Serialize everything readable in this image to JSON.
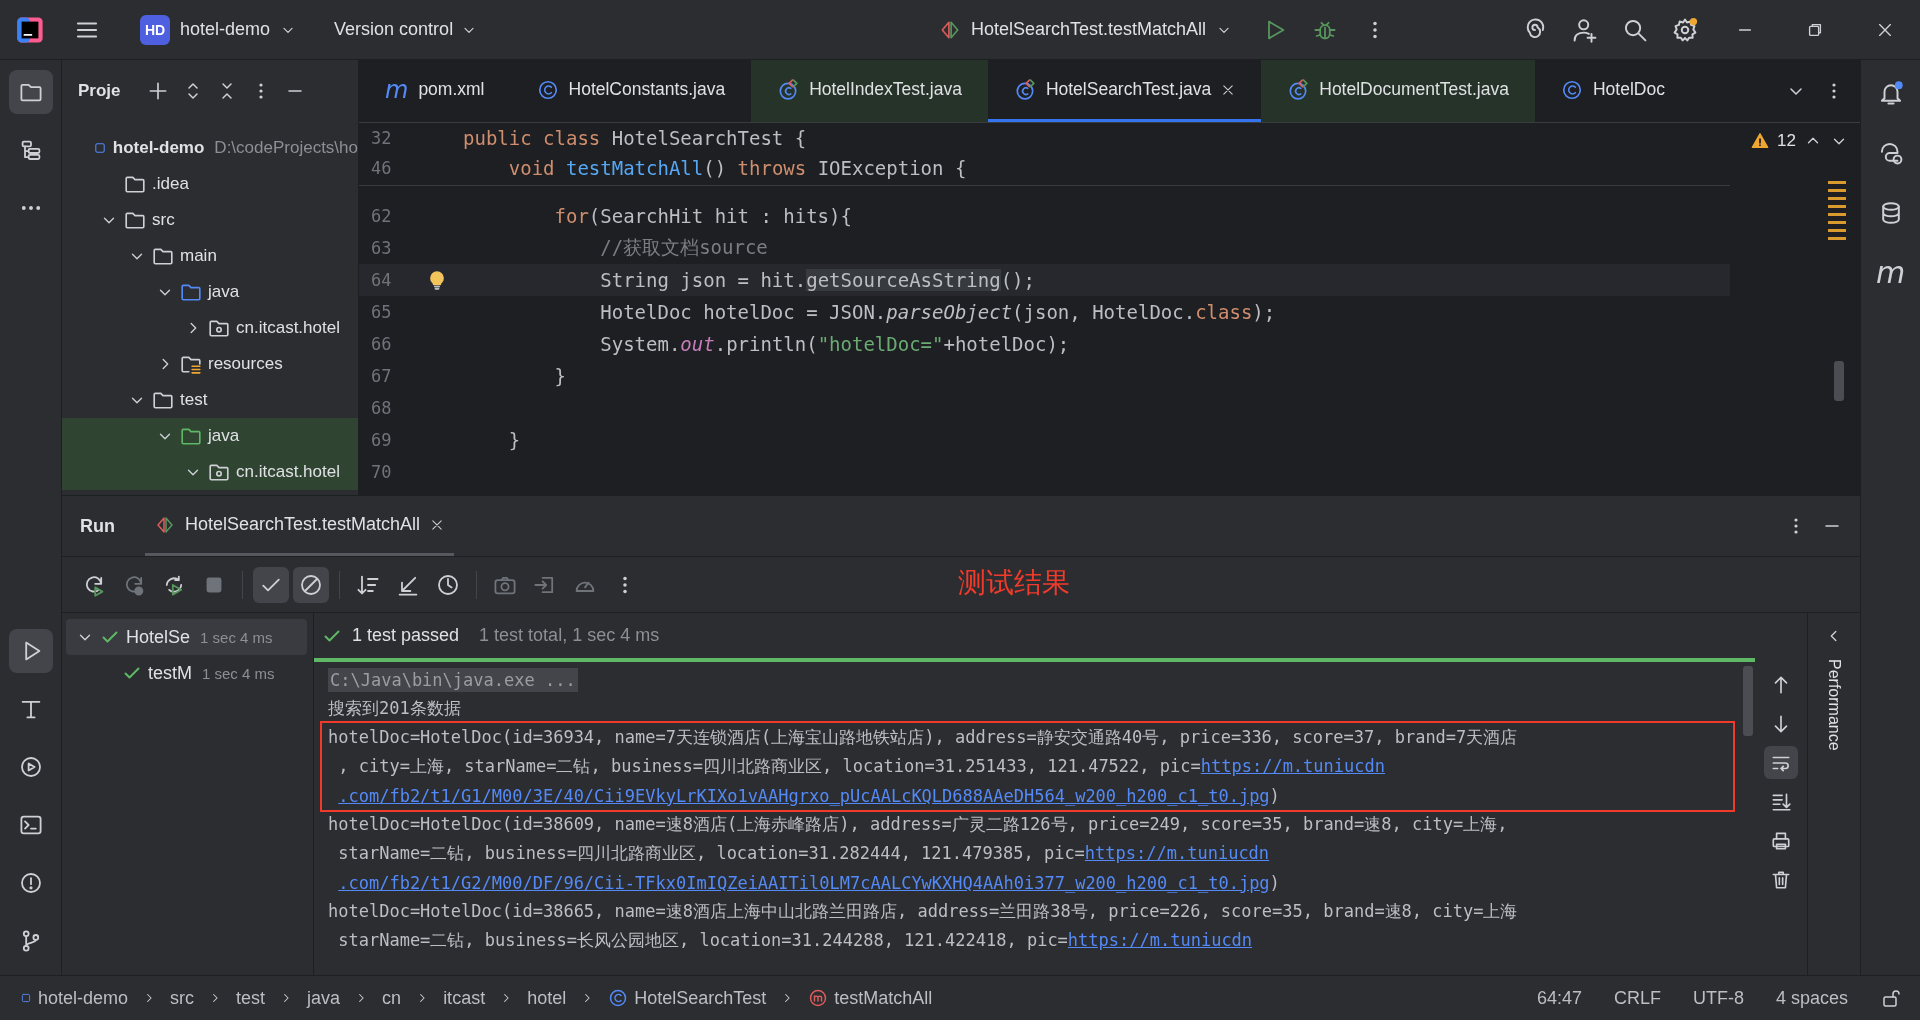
{
  "toolbar": {
    "project_badge": "HD",
    "project": "hotel-demo",
    "vcs": "Version control",
    "run_config": "HotelSearchTest.testMatchAll"
  },
  "left_tools": [
    {
      "kind": "project",
      "selected": true
    },
    {
      "kind": "structure",
      "selected": false
    },
    {
      "kind": "more",
      "selected": false
    },
    {
      "kind": "run",
      "selected": true
    },
    {
      "kind": "build",
      "selected": false
    },
    {
      "kind": "services",
      "selected": false
    },
    {
      "kind": "terminal",
      "selected": false
    },
    {
      "kind": "problems",
      "selected": false
    },
    {
      "kind": "git",
      "selected": false
    }
  ],
  "right_tools": [
    {
      "kind": "notifications",
      "badge": true
    },
    {
      "kind": "assistant"
    },
    {
      "kind": "database"
    },
    {
      "kind": "maven",
      "glyph": "m"
    }
  ],
  "project_panel": {
    "title": "Proje",
    "tree": [
      {
        "label": "hotel-demo",
        "path": "D:\\codeProjects\\ho",
        "kind": "module",
        "highlighted": false,
        "children": [
          {
            "label": ".idea",
            "kind": "folder",
            "highlighted": false
          },
          {
            "label": "src",
            "kind": "folder",
            "expanded": true,
            "highlighted": false,
            "children": [
              {
                "label": "main",
                "kind": "folder",
                "expanded": true,
                "highlighted": false,
                "children": [
                  {
                    "label": "java",
                    "kind": "source",
                    "expanded": true,
                    "highlighted": false,
                    "children": [
                      {
                        "label": "cn.itcast.hotel",
                        "kind": "package",
                        "expanded": false,
                        "highlighted": false
                      }
                    ]
                  },
                  {
                    "label": "resources",
                    "kind": "resources",
                    "expanded": false,
                    "highlighted": false
                  }
                ]
              },
              {
                "label": "test",
                "kind": "folder",
                "expanded": true,
                "highlighted": false,
                "children": [
                  {
                    "label": "java",
                    "kind": "test-source",
                    "expanded": true,
                    "highlighted": true,
                    "children": [
                      {
                        "label": "cn.itcast.hotel",
                        "kind": "package",
                        "expanded": true,
                        "highlighted": true
                      }
                    ]
                  }
                ]
              }
            ]
          }
        ]
      }
    ]
  },
  "editor_tabs": [
    {
      "label": "pom.xml",
      "kind": "maven",
      "glyph": "m",
      "test": false,
      "selected": false
    },
    {
      "label": "HotelConstants.java",
      "kind": "class",
      "test": false,
      "selected": false
    },
    {
      "label": "HotelIndexTest.java",
      "kind": "test-class",
      "test": true,
      "selected": false
    },
    {
      "label": "HotelSearchTest.java",
      "kind": "test-class",
      "test": false,
      "selected": true
    },
    {
      "label": "HotelDocumentTest.java",
      "kind": "test-class",
      "test": true,
      "selected": false
    },
    {
      "label": "HotelDoc",
      "kind": "class",
      "test": false,
      "selected": false
    }
  ],
  "editor": {
    "warnings": "12",
    "sticky_lines": [
      {
        "number": "32",
        "tokens": [
          {
            "text": "public class ",
            "kind": "keyword"
          },
          {
            "text": "HotelSearchTest {",
            "kind": "plain"
          }
        ]
      },
      {
        "number": "46",
        "tokens": [
          {
            "text": "    void ",
            "kind": "keyword"
          },
          {
            "text": "testMatchAll",
            "kind": "declaration"
          },
          {
            "text": "() ",
            "kind": "plain"
          },
          {
            "text": "throws ",
            "kind": "keyword"
          },
          {
            "text": "IOException {",
            "kind": "plain"
          }
        ]
      }
    ],
    "lines": [
      {
        "number": "62",
        "current": false,
        "tokens": [
          {
            "text": "        for",
            "kind": "keyword"
          },
          {
            "text": "(SearchHit hit : hits){",
            "kind": "plain"
          }
        ]
      },
      {
        "number": "63",
        "current": false,
        "tokens": [
          {
            "text": "            //获取文档source",
            "kind": "comment"
          }
        ]
      },
      {
        "number": "64",
        "current": true,
        "tokens": [
          {
            "text": "            String json = hit.",
            "kind": "plain"
          },
          {
            "text": "getSourceAsString",
            "kind": "usage"
          },
          {
            "text": "();",
            "kind": "plain"
          }
        ]
      },
      {
        "number": "65",
        "current": false,
        "tokens": [
          {
            "text": "            HotelDoc hotelDoc = JSON.",
            "kind": "plain"
          },
          {
            "text": "parseObject",
            "kind": "static"
          },
          {
            "text": "(json, HotelDoc.",
            "kind": "plain"
          },
          {
            "text": "class",
            "kind": "keyword"
          },
          {
            "text": ");",
            "kind": "plain"
          }
        ]
      },
      {
        "number": "66",
        "current": false,
        "tokens": [
          {
            "text": "            System.",
            "kind": "plain"
          },
          {
            "text": "out",
            "kind": "field"
          },
          {
            "text": ".println(",
            "kind": "plain"
          },
          {
            "text": "\"hotelDoc=\"",
            "kind": "string"
          },
          {
            "text": "+hotelDoc);",
            "kind": "plain"
          }
        ]
      },
      {
        "number": "67",
        "current": false,
        "tokens": [
          {
            "text": "        }",
            "kind": "plain"
          }
        ]
      },
      {
        "number": "68",
        "current": false
      },
      {
        "number": "69",
        "current": false,
        "tokens": [
          {
            "text": "    }",
            "kind": "plain"
          }
        ]
      },
      {
        "number": "70",
        "current": false
      }
    ]
  },
  "run_panel": {
    "title": "Run",
    "tab": "HotelSearchTest.testMatchAll",
    "annotation": "测试结果",
    "filters": [
      {
        "kind": "passed",
        "on": true
      },
      {
        "kind": "ignored",
        "on": true
      }
    ],
    "tests": [
      {
        "label": "HotelSe",
        "time": "1 sec 4 ms",
        "passed": true,
        "expanded": true,
        "selected": true,
        "children": [
          {
            "label": "testM",
            "time": "1 sec 4 ms",
            "passed": true,
            "selected": false
          }
        ]
      }
    ],
    "status": "1 test passed",
    "summary": "1 test total, 1 sec 4 ms",
    "progress": {
      "level": 1
    },
    "console": [
      {
        "kind": "command",
        "highlighted": false,
        "lines": [
          [
            {
              "text": "C:\\Java\\bin\\java.exe ..."
            }
          ]
        ]
      },
      {
        "kind": "output",
        "highlighted": false,
        "lines": [
          [
            {
              "text": "搜索到201条数据"
            }
          ]
        ]
      },
      {
        "kind": "output",
        "highlighted": true,
        "lines": [
          [
            {
              "text": "hotelDoc=HotelDoc(id=36934, name=7天连锁酒店(上海宝山路地铁站店), address=静安交通路40号, price=336, score=37, brand=7天酒店"
            }
          ],
          [
            {
              "text": ", city=上海, starName=二钻, business=四川北路商业区, location=31.251433, 121.47522, pic="
            },
            {
              "link": "https://m.tuniucdn"
            }
          ],
          [
            {
              "link": ".com/fb2/t1/G1/M00/3E/40/Cii9EVkyLrKIXo1vAAHgrxo_pUcAALcKQLD688AAeDH564_w200_h200_c1_t0.jpg"
            },
            {
              "text": ")"
            }
          ]
        ]
      },
      {
        "kind": "output",
        "highlighted": false,
        "lines": [
          [
            {
              "text": "hotelDoc=HotelDoc(id=38609, name=速8酒店(上海赤峰路店), address=广灵二路126号, price=249, score=35, brand=速8, city=上海,"
            }
          ],
          [
            {
              "text": "starName=二钻, business=四川北路商业区, location=31.282444, 121.479385, pic="
            },
            {
              "link": "https://m.tuniucdn"
            }
          ],
          [
            {
              "link": ".com/fb2/t1/G2/M00/DF/96/Cii-TFkx0ImIQZeiAAITil0LM7cAALCYwKXHQ4AAh0i377_w200_h200_c1_t0.jpg"
            },
            {
              "text": ")"
            }
          ]
        ]
      },
      {
        "kind": "output",
        "highlighted": false,
        "lines": [
          [
            {
              "text": "hotelDoc=HotelDoc(id=38665, name=速8酒店上海中山北路兰田路店, address=兰田路38号, price=226, score=35, brand=速8, city=上海"
            }
          ],
          [
            {
              "text": "starName=二钻, business=长风公园地区, location=31.244288, 121.422418, pic="
            },
            {
              "link": "https://m.tuniucdn"
            }
          ]
        ]
      }
    ],
    "side_panel": "Performance"
  },
  "status_bar": {
    "breadcrumbs": [
      {
        "label": "hotel-demo",
        "kind": "module"
      },
      {
        "label": "src",
        "kind": "folder"
      },
      {
        "label": "test",
        "kind": "folder"
      },
      {
        "label": "java",
        "kind": "folder"
      },
      {
        "label": "cn",
        "kind": "folder"
      },
      {
        "label": "itcast",
        "kind": "folder"
      },
      {
        "label": "hotel",
        "kind": "folder"
      },
      {
        "label": "HotelSearchTest",
        "kind": "class"
      },
      {
        "label": "testMatchAll",
        "kind": "method"
      }
    ],
    "position": "64:47",
    "line_separator": "CRLF",
    "encoding": "UTF-8",
    "indent": "4 spaces",
    "locked": false
  }
}
